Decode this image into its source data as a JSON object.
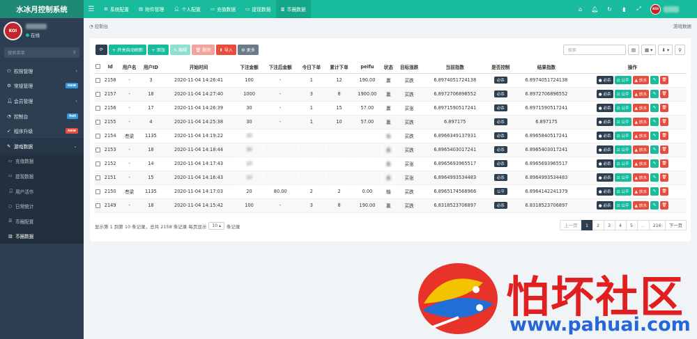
{
  "app": {
    "title": "水冰月控制系统"
  },
  "topnav": [
    {
      "icon": "gear",
      "label": "系统配置",
      "active": false
    },
    {
      "icon": "file",
      "label": "附件管理",
      "active": false
    },
    {
      "icon": "user",
      "label": "个人配置",
      "active": false
    },
    {
      "icon": "card",
      "label": "充值数据",
      "active": false
    },
    {
      "icon": "card",
      "label": "提现数据",
      "active": false
    },
    {
      "icon": "chart",
      "label": "币圈数据",
      "active": true
    }
  ],
  "user": {
    "status": "在线",
    "avatar_text": "KOI"
  },
  "sidebar": {
    "search_placeholder": "搜索菜单",
    "items": [
      {
        "label": "权限管理",
        "icon": "users",
        "arrow": "‹"
      },
      {
        "label": "常规管理",
        "icon": "cogs",
        "badge": "new",
        "badge_color": "#3498db"
      },
      {
        "label": "会员管理",
        "icon": "user",
        "arrow": "‹"
      },
      {
        "label": "控制台",
        "icon": "dashboard",
        "badge": "hot",
        "badge_color": "#3498db"
      },
      {
        "label": "程序升级",
        "icon": "rocket",
        "badge": "new",
        "badge_color": "#e74c3c"
      },
      {
        "label": "游戏数据",
        "icon": "edit",
        "arrow": "⌄",
        "open": true
      }
    ],
    "subitems": [
      {
        "label": "充值数据",
        "icon": "card"
      },
      {
        "label": "提现数据",
        "icon": "card"
      },
      {
        "label": "用户活作",
        "icon": "user"
      },
      {
        "label": "日常统计",
        "icon": "circle"
      },
      {
        "label": "币圈配置",
        "icon": "list"
      },
      {
        "label": "币圈数据",
        "icon": "chart",
        "active": true
      }
    ]
  },
  "breadcrumb": {
    "left": "控制台",
    "right": "游戏数据"
  },
  "toolbar": {
    "refresh_icon": "⟳",
    "auto_refresh": "+ 开关自动刷新",
    "add": "+ 添加",
    "edit": "✎ 编辑",
    "delete": "🗑 删除",
    "import": "⬆ 导入",
    "more": "⚙ 更多",
    "search_placeholder": "搜索"
  },
  "table": {
    "headers": [
      "",
      "Id",
      "用户名",
      "用户ID",
      "开始时间",
      "下注金额",
      "下注后金额",
      "今日下单",
      "累计下单",
      "peifu",
      "状态",
      "目标涨跌",
      "当前指数",
      "是否控制",
      "结果指数",
      "操作"
    ],
    "rows": [
      [
        "2158",
        "-",
        "3",
        "2020-11-04 14:26:41",
        "100",
        "-",
        "1",
        "12",
        "190.00",
        "赢",
        "买跌",
        "6.8974051724138",
        "必杀",
        "6.8974051724138"
      ],
      [
        "2157",
        "-",
        "18",
        "2020-11-04 14:27:40",
        "1000",
        "-",
        "3",
        "8",
        "1900.00",
        "赢",
        "买跌",
        "6.8972706896552",
        "必杀",
        "6.8972706896552"
      ],
      [
        "2156",
        "-",
        "17",
        "2020-11-04 14:26:39",
        "30",
        "-",
        "1",
        "15",
        "57.00",
        "赢",
        "买张",
        "6.8971590517241",
        "必杀",
        "6.8971590517241"
      ],
      [
        "2155",
        "-",
        "4",
        "2020-11-04 14:25:38",
        "30",
        "-",
        "1",
        "10",
        "57.00",
        "赢",
        "买跌",
        "6.897175",
        "必杀",
        "6.897175"
      ],
      [
        "2154",
        "叁梁",
        "1135",
        "2020-11-04 14:19:22",
        "20",
        "",
        "",
        "",
        "",
        "输",
        "买跌",
        "6.8966349137931",
        "必杀",
        "6.8965840517241"
      ],
      [
        "2153",
        "-",
        "18",
        "2020-11-04 14:18:44",
        "30",
        "",
        "",
        "",
        "",
        "赢",
        "买跌",
        "6.8965403017241",
        "必杀",
        "6.8965403017241"
      ],
      [
        "2152",
        "-",
        "14",
        "2020-11-04 14:17:43",
        "10",
        "",
        "",
        "",
        "",
        "赢",
        "买张",
        "6.8965693965517",
        "必杀",
        "6.8965693965517"
      ],
      [
        "2151",
        "-",
        "15",
        "2020-11-04 14:16:43",
        "10",
        "",
        "",
        "",
        "",
        "赢",
        "买张",
        "6.8964993534483",
        "必杀",
        "6.8964993534483"
      ],
      [
        "2150",
        "叁梁",
        "1135",
        "2020-11-04 14:17:03",
        "20",
        "80.00",
        "2",
        "2",
        "0.00",
        "输",
        "买跌",
        "6.8965174568966",
        "公平",
        "6.8964142241379"
      ],
      [
        "2149",
        "-",
        "18",
        "2020-11-04 14:15:42",
        "100",
        "-",
        "3",
        "8",
        "190.00",
        "赢",
        "买跌",
        "6.8318523706897",
        "必杀",
        "6.8318523706897"
      ]
    ],
    "row_actions": {
      "kill": "必杀",
      "fair": "公平",
      "release": "放水"
    }
  },
  "footer": {
    "summary_prefix": "显示第 1 到第 10 条记录，总共 2158 条记录 每页显示",
    "page_size": "10 ▴",
    "summary_suffix": "条记录"
  },
  "pagination": [
    "上一页",
    "1",
    "2",
    "3",
    "4",
    "5",
    "...",
    "216",
    "下一页"
  ],
  "watermark": {
    "title": "怕坏社区",
    "url": "www.pahuai.com"
  }
}
